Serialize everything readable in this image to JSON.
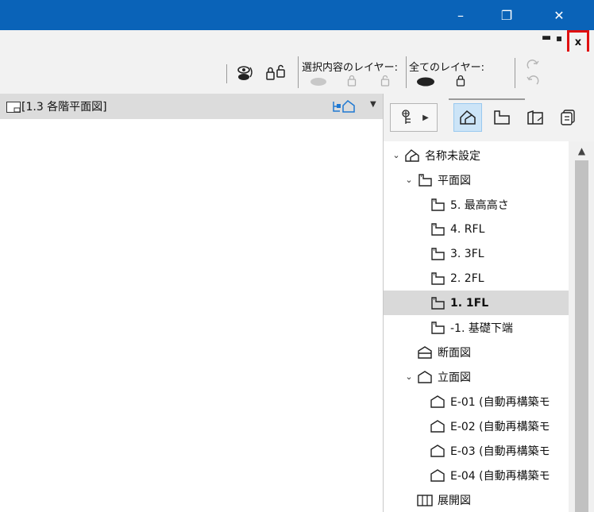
{
  "window": {
    "minimize_glyph": "–",
    "restore_glyph": "❐",
    "close_glyph": "✕"
  },
  "doc_controls": {
    "minimize_glyph": "▬",
    "restore_glyph": "▪",
    "close_glyph": "x"
  },
  "toolbar": {
    "selected_layer_label": "選択内容のレイヤー:",
    "all_layers_label": "全てのレイヤー:"
  },
  "tab": {
    "title": "[1.3 各階平面図]"
  },
  "navigator": {
    "tree": [
      {
        "label": "名称未設定",
        "icon": "project-icon",
        "chevron": "⌄"
      },
      {
        "label": "平面図",
        "icon": "floorplan-icon",
        "chevron": "⌄"
      },
      {
        "label": "5. 最高高さ",
        "icon": "story-icon"
      },
      {
        "label": "4. RFL",
        "icon": "story-icon"
      },
      {
        "label": "3. 3FL",
        "icon": "story-icon"
      },
      {
        "label": "2. 2FL",
        "icon": "story-icon"
      },
      {
        "label": "1. 1FL",
        "icon": "story-icon",
        "selected": true
      },
      {
        "label": "-1. 基礎下端",
        "icon": "story-icon"
      },
      {
        "label": "断面図",
        "icon": "section-icon"
      },
      {
        "label": "立面図",
        "icon": "elevation-icon",
        "chevron": "⌄"
      },
      {
        "label": "E-01 (自動再構築モ",
        "icon": "elevation-icon"
      },
      {
        "label": "E-02 (自動再構築モ",
        "icon": "elevation-icon"
      },
      {
        "label": "E-03 (自動再構築モ",
        "icon": "elevation-icon"
      },
      {
        "label": "E-04 (自動再構築モ",
        "icon": "elevation-icon"
      },
      {
        "label": "展開図",
        "icon": "interior-elevation-icon"
      }
    ]
  },
  "colors": {
    "titlebar": "#0a63b8",
    "highlight": "#e01010",
    "active_nav": "#cce4f7"
  }
}
